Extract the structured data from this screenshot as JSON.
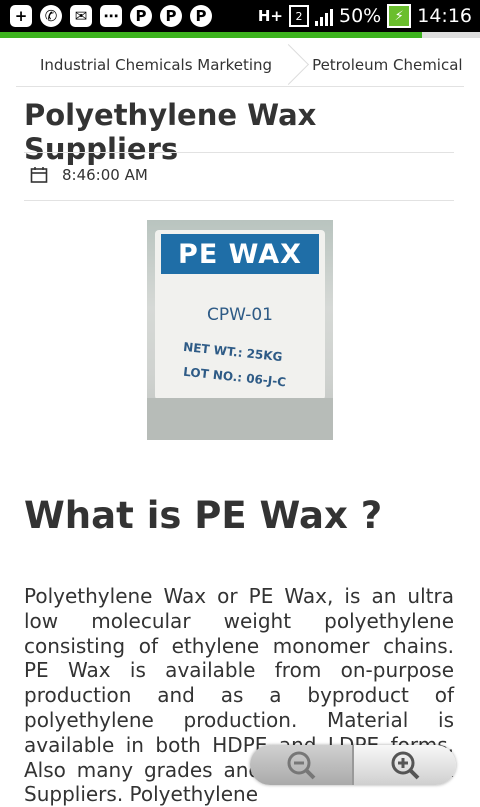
{
  "status_bar": {
    "notification_icons": [
      "plus-icon",
      "whatsapp-icon",
      "mail-icon",
      "blackberry-icon",
      "p-icon",
      "p-icon",
      "p-icon"
    ],
    "network": "H+",
    "sim_slot": "2",
    "battery": "50%",
    "time": "14:16"
  },
  "page_load_progress": 0.88,
  "breadcrumb": {
    "items": [
      {
        "label": "Industrial Chemicals Marketing"
      },
      {
        "label": "Petroleum Chemical"
      }
    ]
  },
  "article": {
    "title": "Polyethylene Wax Suppliers",
    "time": "8:46:00 AM",
    "image": {
      "band_text": "PE WAX",
      "code": "CPW-01",
      "weight_text": "NET WT.: 25KG",
      "lot_text": "LOT NO.: 06-J-C"
    },
    "heading": "What is PE Wax ?",
    "paragraph": "Polyethylene Wax or PE Wax, is an ultra low molecular weight polyethylene consisting of ethylene monomer chains. PE Wax is available from on-purpose production and as a byproduct of polyethylene production. Material is available in both HDPE and LDPE forms. Also many grades and Polyethylene Wax Suppliers. Polyethylene"
  },
  "zoom_controls": {
    "zoom_out_icon": "zoom-out-icon",
    "zoom_in_icon": "zoom-in-icon"
  }
}
